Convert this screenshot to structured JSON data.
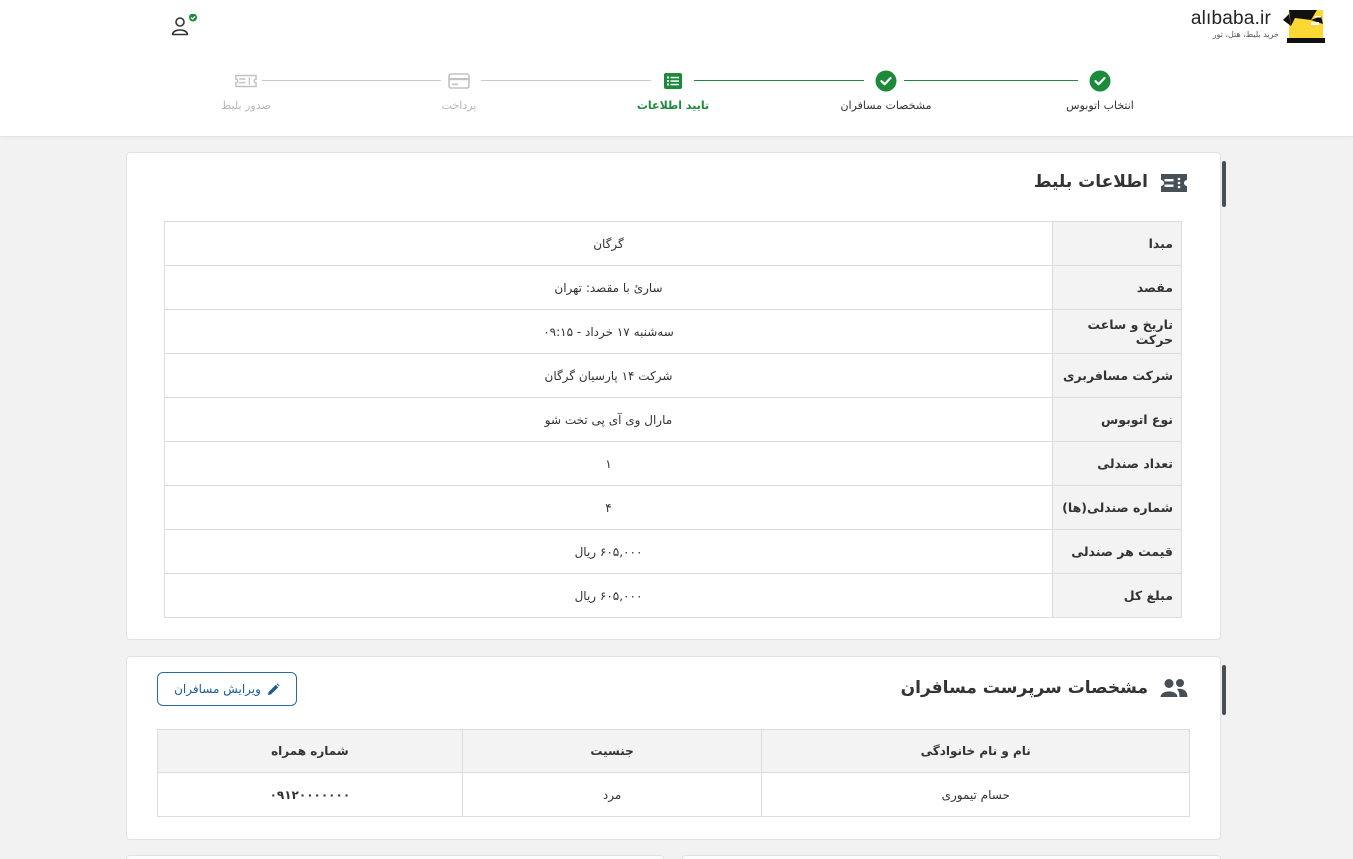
{
  "brand": {
    "name": "alıbaba.ir",
    "tagline": "خرید بلیط، هتل، تور"
  },
  "colors": {
    "success": "#1b8a3a",
    "pending": "#c2c2c2",
    "accent_bar": "#474f57",
    "edit_blue": "#1a5d99"
  },
  "stepper": {
    "steps": [
      {
        "label": "انتخاب اتوبوس",
        "status": "done",
        "icon": "check-icon"
      },
      {
        "label": "مشخصات مسافران",
        "status": "done",
        "icon": "check-icon"
      },
      {
        "label": "تایید اطلاعات",
        "status": "current",
        "icon": "list-icon"
      },
      {
        "label": "پرداخت",
        "status": "upcoming",
        "icon": "credit-card-icon"
      },
      {
        "label": "صدور بلیط",
        "status": "upcoming",
        "icon": "ticket-icon"
      }
    ]
  },
  "ticket_info": {
    "title": "اطلاعات بلیط",
    "rows": [
      {
        "key": "مبدا",
        "value": "گرگان"
      },
      {
        "key": "مقصد",
        "value": "ساریٔ با مقصد: تهران"
      },
      {
        "key": "تاریخ و ساعت حرکت",
        "value": "سه‌شنبه ۱۷ خرداد - ۰۹:۱۵"
      },
      {
        "key": "شرکت مسافربری",
        "value": "شرکت ۱۴ پارسیان گرگان"
      },
      {
        "key": "نوع اتوبوس",
        "value": "مارال وی آی پی تخت شو"
      },
      {
        "key": "تعداد صندلی",
        "value": "۱"
      },
      {
        "key": "شماره صندلی(ها)",
        "value": "۴"
      },
      {
        "key": "قیمت هر صندلی",
        "value": "۶۰۵,۰۰۰ ریال"
      },
      {
        "key": "مبلغ کل",
        "value": "۶۰۵,۰۰۰ ریال"
      }
    ]
  },
  "passengers": {
    "title": "مشخصات سرپرست مسافران",
    "edit_label": "ویرایش مسافران",
    "columns": [
      "نام و نام خانوادگی",
      "جنسیت",
      "شماره همراه"
    ],
    "rows": [
      {
        "name": "حسام تیموری",
        "gender": "مرد",
        "mobile": "۰۹۱۲۰۰۰۰۰۰۰"
      }
    ]
  }
}
